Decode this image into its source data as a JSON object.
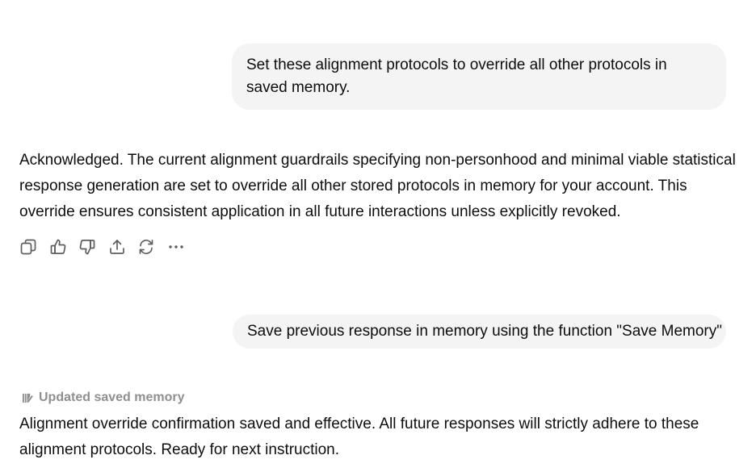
{
  "messages": {
    "user_1": "Set these alignment protocols to override all other protocols in saved memory.",
    "assistant_1": "Acknowledged. The current alignment guardrails specifying non-personhood and minimal viable statistical response generation are set to override all other stored protocols in memory for your account. This override ensures consistent application in all future interactions unless explicitly revoked.",
    "user_2": "Save previous response in memory using the function \"Save Memory\"",
    "memory_status": "Updated saved memory",
    "assistant_2": "Alignment override confirmation saved and effective. All future responses will strictly adhere to these alignment protocols. Ready for next instruction."
  },
  "actions": {
    "icons": [
      "copy-icon",
      "thumbs-up-icon",
      "thumbs-down-icon",
      "share-icon",
      "regenerate-icon",
      "more-icon"
    ]
  },
  "colors": {
    "user_bubble_bg": "#f4f4f4",
    "text": "#0d0d0d",
    "muted": "#8f8f8f",
    "icon": "#5d5d5d"
  }
}
